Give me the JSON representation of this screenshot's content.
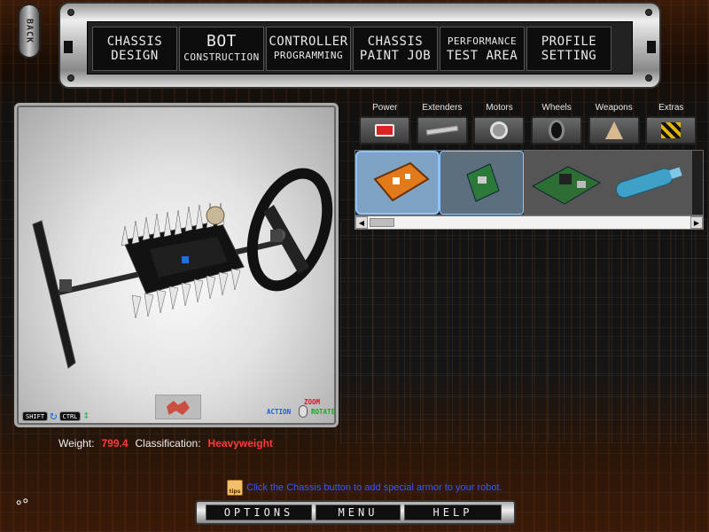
{
  "back_button": {
    "label": "BACK"
  },
  "nav": {
    "tabs": [
      {
        "line1": "CHASSIS",
        "line2": "DESIGN"
      },
      {
        "line1": "BOT",
        "line2": "CONSTRUCTION"
      },
      {
        "line1": "CONTROLLER",
        "line2": "PROGRAMMING"
      },
      {
        "line1": "CHASSIS",
        "line2": "PAINT JOB"
      },
      {
        "line1": "PERFORMANCE",
        "line2": "TEST AREA"
      },
      {
        "line1": "PROFILE",
        "line2": "SETTING"
      }
    ]
  },
  "viewport": {
    "keys": {
      "shift": "SHIFT",
      "ctrl": "CTRL"
    },
    "mouse_legend": {
      "zoom": "ZOOM",
      "action": "ACTION",
      "rotate": "ROTATE"
    }
  },
  "stats": {
    "weight_label": "Weight:",
    "weight_value": "799.4",
    "class_label": "Classification:",
    "class_value": "Heavyweight"
  },
  "parts": {
    "categories": [
      "Power",
      "Extenders",
      "Motors",
      "Wheels",
      "Weapons",
      "Extras"
    ],
    "items": [
      "chassis-orange",
      "circuit-board-small",
      "circuit-board-large",
      "battery-cylinder"
    ]
  },
  "tip": {
    "icon_label": "tips",
    "text": "Click the Chassis button to add special armor to your robot."
  },
  "bottom": {
    "options": "OPTIONS",
    "menu": "MENU",
    "help": "HELP"
  },
  "colors": {
    "weight_value": "#ff3a3a",
    "tip_text": "#3a56ff",
    "zoom": "#d8142c",
    "action": "#1e5bd8",
    "rotate": "#16a828"
  }
}
